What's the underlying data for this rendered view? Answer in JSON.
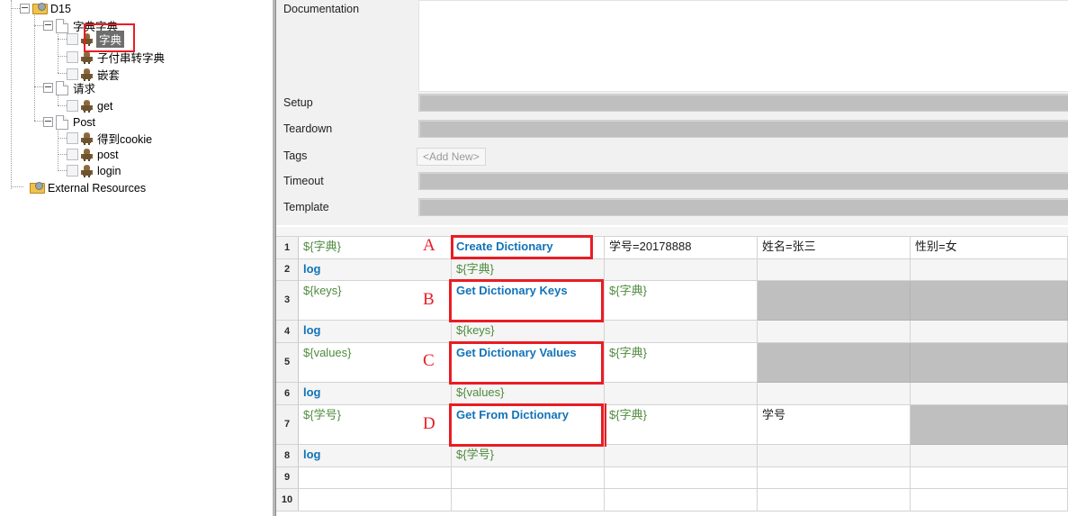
{
  "tree": {
    "root": {
      "label": "D15",
      "icon": "suite-folder-icon"
    },
    "nodes": [
      {
        "label": "字典字典",
        "icon": "file-icon",
        "level": 1,
        "type": "suite"
      },
      {
        "label": "字典",
        "icon": "robot-icon",
        "level": 2,
        "type": "test",
        "selected": true
      },
      {
        "label": "子付串转字典",
        "icon": "robot-icon",
        "level": 2,
        "type": "test"
      },
      {
        "label": "嵌套",
        "icon": "robot-icon",
        "level": 2,
        "type": "test"
      },
      {
        "label": "请求",
        "icon": "file-icon",
        "level": 1,
        "type": "suite"
      },
      {
        "label": "get",
        "icon": "robot-icon",
        "level": 2,
        "type": "test"
      },
      {
        "label": "Post",
        "icon": "file-icon",
        "level": 1,
        "type": "suite"
      },
      {
        "label": "得到cookie",
        "icon": "robot-icon",
        "level": 2,
        "type": "test"
      },
      {
        "label": "post",
        "icon": "robot-icon",
        "level": 2,
        "type": "test"
      },
      {
        "label": "login",
        "icon": "robot-icon",
        "level": 2,
        "type": "test"
      }
    ],
    "external": {
      "label": "External Resources",
      "icon": "suite-folder-icon"
    }
  },
  "settings": {
    "documentation_label": "Documentation",
    "documentation_value": "",
    "setup_label": "Setup",
    "setup_value": "",
    "teardown_label": "Teardown",
    "teardown_value": "",
    "tags_label": "Tags",
    "tags_add_new": "<Add New>",
    "timeout_label": "Timeout",
    "timeout_value": "",
    "template_label": "Template",
    "template_value": ""
  },
  "grid": {
    "row_numbers": [
      "1",
      "2",
      "3",
      "4",
      "5",
      "6",
      "7",
      "8",
      "9",
      "10"
    ],
    "rows": [
      {
        "n": "1",
        "cells": [
          {
            "text": "${字典}",
            "style": "var"
          },
          {
            "text": "Create Dictionary",
            "style": "kw"
          },
          {
            "text": "学号=20178888",
            "style": "txt"
          },
          {
            "text": "姓名=张三",
            "style": "txt"
          },
          {
            "text": "性别=女",
            "style": "txt"
          }
        ]
      },
      {
        "n": "2",
        "cells": [
          {
            "text": "log",
            "style": "kw"
          },
          {
            "text": "${字典}",
            "style": "var"
          },
          {
            "text": "",
            "style": "txt"
          },
          {
            "text": "",
            "style": "txt"
          },
          {
            "text": "",
            "style": "txt"
          }
        ]
      },
      {
        "n": "3",
        "cells": [
          {
            "text": "${keys}",
            "style": "var"
          },
          {
            "text": "Get Dictionary Keys",
            "style": "kw"
          },
          {
            "text": "${字典}",
            "style": "var"
          },
          {
            "text": "",
            "style": "gray"
          },
          {
            "text": "",
            "style": "gray"
          }
        ]
      },
      {
        "n": "4",
        "cells": [
          {
            "text": "log",
            "style": "kw"
          },
          {
            "text": "${keys}",
            "style": "var"
          },
          {
            "text": "",
            "style": "txt"
          },
          {
            "text": "",
            "style": "txt"
          },
          {
            "text": "",
            "style": "txt"
          }
        ]
      },
      {
        "n": "5",
        "cells": [
          {
            "text": "${values}",
            "style": "var"
          },
          {
            "text": "Get Dictionary Values",
            "style": "kw"
          },
          {
            "text": "${字典}",
            "style": "var"
          },
          {
            "text": "",
            "style": "gray"
          },
          {
            "text": "",
            "style": "gray"
          }
        ]
      },
      {
        "n": "6",
        "cells": [
          {
            "text": "log",
            "style": "kw"
          },
          {
            "text": "${values}",
            "style": "var"
          },
          {
            "text": "",
            "style": "txt"
          },
          {
            "text": "",
            "style": "txt"
          },
          {
            "text": "",
            "style": "txt"
          }
        ]
      },
      {
        "n": "7",
        "cells": [
          {
            "text": "${学号}",
            "style": "var"
          },
          {
            "text": "Get From Dictionary",
            "style": "kw"
          },
          {
            "text": "${字典}",
            "style": "var"
          },
          {
            "text": "学号",
            "style": "txt"
          },
          {
            "text": "",
            "style": "gray"
          }
        ]
      },
      {
        "n": "8",
        "cells": [
          {
            "text": "log",
            "style": "kw"
          },
          {
            "text": "${学号}",
            "style": "var"
          },
          {
            "text": "",
            "style": "txt"
          },
          {
            "text": "",
            "style": "txt"
          },
          {
            "text": "",
            "style": "txt"
          }
        ]
      },
      {
        "n": "9",
        "cells": [
          {
            "text": "",
            "style": "txt"
          },
          {
            "text": "",
            "style": "txt"
          },
          {
            "text": "",
            "style": "txt"
          },
          {
            "text": "",
            "style": "txt"
          },
          {
            "text": "",
            "style": "txt"
          }
        ]
      },
      {
        "n": "10",
        "cells": [
          {
            "text": "",
            "style": "txt"
          },
          {
            "text": "",
            "style": "txt"
          },
          {
            "text": "",
            "style": "txt"
          },
          {
            "text": "",
            "style": "txt"
          },
          {
            "text": "",
            "style": "txt"
          }
        ]
      }
    ]
  },
  "annotations": {
    "letters": [
      "A",
      "B",
      "C",
      "D"
    ],
    "color": "#ea1c24"
  }
}
